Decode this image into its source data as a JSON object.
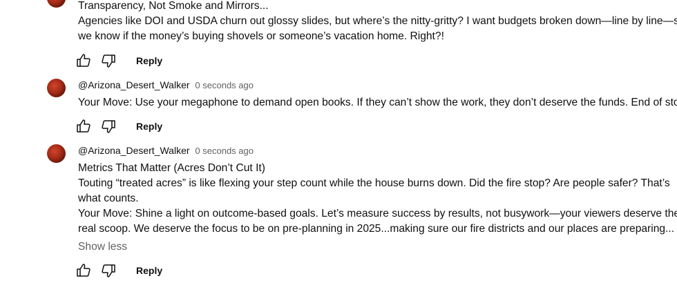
{
  "comments": [
    {
      "author": "",
      "timestamp": "",
      "body": [
        "Transparency, Not Smoke and Mirrors...",
        "Agencies like DOI and USDA churn out glossy slides, but where’s the nitty-gritty? I want budgets broken down—line by line—so",
        "we know if the money’s buying shovels or someone’s vacation home. Right?!"
      ],
      "reply_label": "Reply"
    },
    {
      "author": "@Arizona_Desert_Walker",
      "timestamp": "0 seconds ago",
      "body": [
        "Your Move: Use your megaphone to demand open books. If they can’t show the work, they don’t deserve the funds. End of story"
      ],
      "reply_label": "Reply"
    },
    {
      "author": "@Arizona_Desert_Walker",
      "timestamp": "0 seconds ago",
      "body": [
        "Metrics That Matter (Acres Don’t Cut It)",
        "Touting “treated acres” is like flexing your step count while the house burns down. Did the fire stop? Are people safer? That’s",
        "what counts.",
        "Your Move: Shine a light on outcome-based goals. Let’s measure success by results, not busywork—your viewers deserve the",
        "real scoop. We deserve the focus to be on pre-planning in 2025...making sure our fire districts and our places are preparing..."
      ],
      "show_less_label": "Show less",
      "reply_label": "Reply"
    }
  ],
  "icons": {
    "like": "thumbs-up-icon",
    "dislike": "thumbs-down-icon"
  },
  "colors": {
    "text": "#0f0f0f",
    "secondary": "#606060",
    "avatar": "#a32a17"
  }
}
